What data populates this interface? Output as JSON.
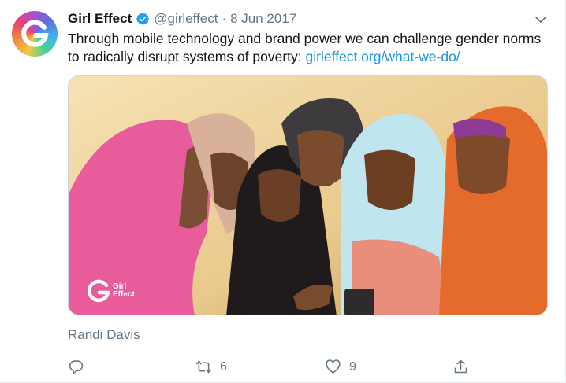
{
  "tweet": {
    "author_name": "Girl Effect",
    "handle": "@girleffect",
    "separator": "·",
    "date": "8 Jun 2017",
    "text": "Through mobile technology and brand power we can challenge gender norms to radically disrupt systems of poverty: ",
    "link_text": "girleffect.org/what-we-do/",
    "media_watermark": {
      "line1": "Girl",
      "line2": "Effect"
    },
    "photo_credit": "Randi Davis"
  },
  "actions": {
    "reply_count": "",
    "retweet_count": "6",
    "like_count": "9"
  },
  "colors": {
    "accent": "#1b95e0",
    "muted": "#657786",
    "verified": "#1da1f2"
  },
  "icons": [
    "girl-effect-logo-icon",
    "verified-badge-icon",
    "chevron-down-icon",
    "reply-icon",
    "retweet-icon",
    "like-icon",
    "share-icon"
  ]
}
